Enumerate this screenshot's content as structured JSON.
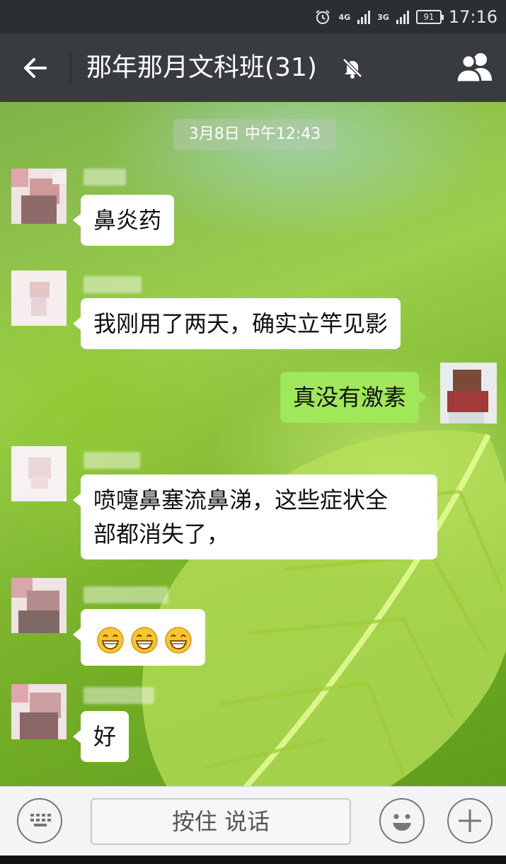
{
  "status_bar": {
    "network_1": "4G",
    "network_2": "3G",
    "battery": "91",
    "time": "17:16"
  },
  "header": {
    "title": "那年那月文科班(31)",
    "muted": true,
    "back_icon": "back-arrow-icon",
    "members_icon": "group-members-icon"
  },
  "chat": {
    "timestamp": "3月8日 中午12:43",
    "messages": [
      {
        "side": "left",
        "text": "鼻炎药"
      },
      {
        "side": "left",
        "text": "我刚用了两天，确实立竿见影"
      },
      {
        "side": "right",
        "text": "真没有激素"
      },
      {
        "side": "left",
        "lines": [
          "喷嚏鼻塞流鼻涕，这些症状全",
          "部都消失了，"
        ]
      },
      {
        "side": "left",
        "emoji": "grin-emoji",
        "emoji_count": 3
      },
      {
        "side": "left",
        "text": "好"
      }
    ]
  },
  "input_bar": {
    "hold_to_talk": "按住 说话",
    "keyboard_icon": "keyboard-icon",
    "emoji_icon": "smiley-icon",
    "plus_icon": "plus-icon"
  },
  "colors": {
    "appbar": "#383c41",
    "outgoing_bubble": "#a0e75a",
    "incoming_bubble": "#ffffff"
  }
}
